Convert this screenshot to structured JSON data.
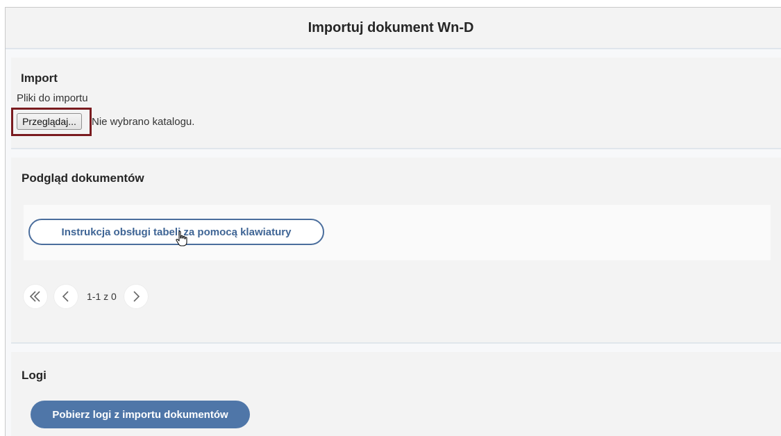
{
  "header": {
    "title": "Importuj dokument Wn-D"
  },
  "import": {
    "title": "Import",
    "files_label": "Pliki do importu",
    "browse_label": "Przeglądaj...",
    "status": "Nie wybrano katalogu."
  },
  "preview": {
    "title": "Podgląd dokumentów",
    "keyboard_help_label": "Instrukcja obsługi tabeli za pomocą klawiatury",
    "pagination": {
      "range_text": "1-1 z 0"
    }
  },
  "logs": {
    "title": "Logi",
    "download_label": "Pobierz logi z importu dokumentów"
  },
  "colors": {
    "accent": "#4f76a8",
    "highlight_border": "#7a1b1f",
    "panel_bg": "#f3f3f3"
  }
}
